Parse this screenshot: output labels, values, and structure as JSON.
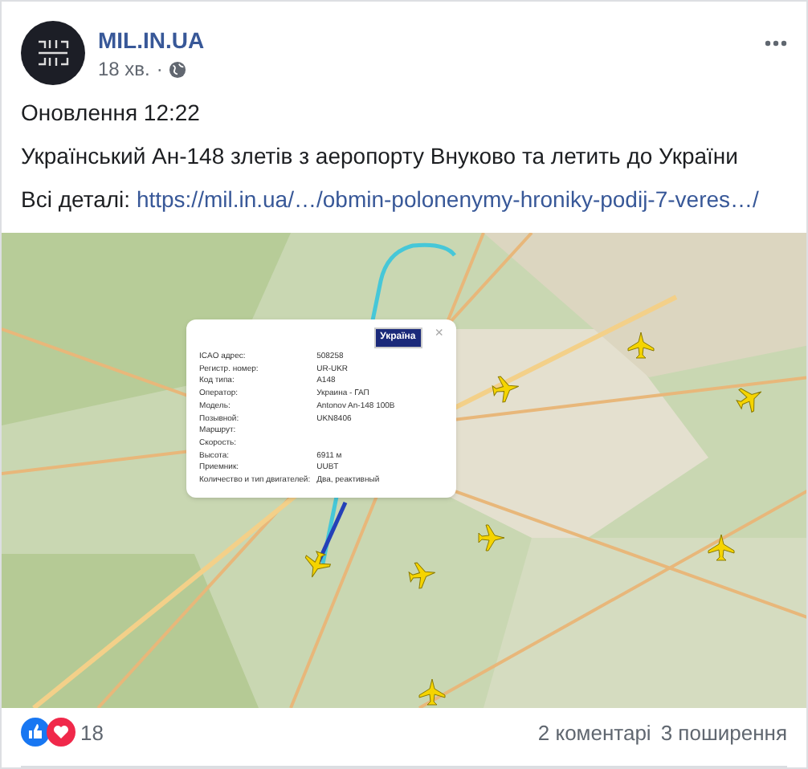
{
  "post": {
    "author": "MIL.IN.UA",
    "time": "18 хв.",
    "separator": "·",
    "lines": [
      "Оновлення 12:22",
      "Український Ан-148 злетів з аеропорту Внуково та летить до України"
    ],
    "link_label": "Всі деталі:",
    "link": "https://mil.in.ua/…/obmin-polonenymy-hroniky-podij-7-veres…/"
  },
  "popup": {
    "close": "×",
    "badge": "Україна",
    "rows": [
      {
        "label": "ICAO адрес:",
        "value": "508258"
      },
      {
        "label": "Регистр. номер:",
        "value": "UR-UKR"
      },
      {
        "label": "Код типа:",
        "value": "A148"
      },
      {
        "label": "Оператор:",
        "value": "Украина - ГАП"
      },
      {
        "label": "Модель:",
        "value": "Antonov An-148 100B"
      },
      {
        "label": "Позывной:",
        "value": "UKN8406"
      },
      {
        "label": "Маршрут:"
      },
      {
        "label": "Скорость:"
      },
      {
        "label": "Высота:",
        "value": "6911 м"
      },
      {
        "label": "Приемник:",
        "value": "UUBT"
      },
      {
        "label": "Количество и тип двигателей:",
        "value": "Два, реактивный"
      }
    ]
  },
  "footer": {
    "reactions": "18",
    "comments": "2 коментарі",
    "shares": "3 поширення"
  }
}
